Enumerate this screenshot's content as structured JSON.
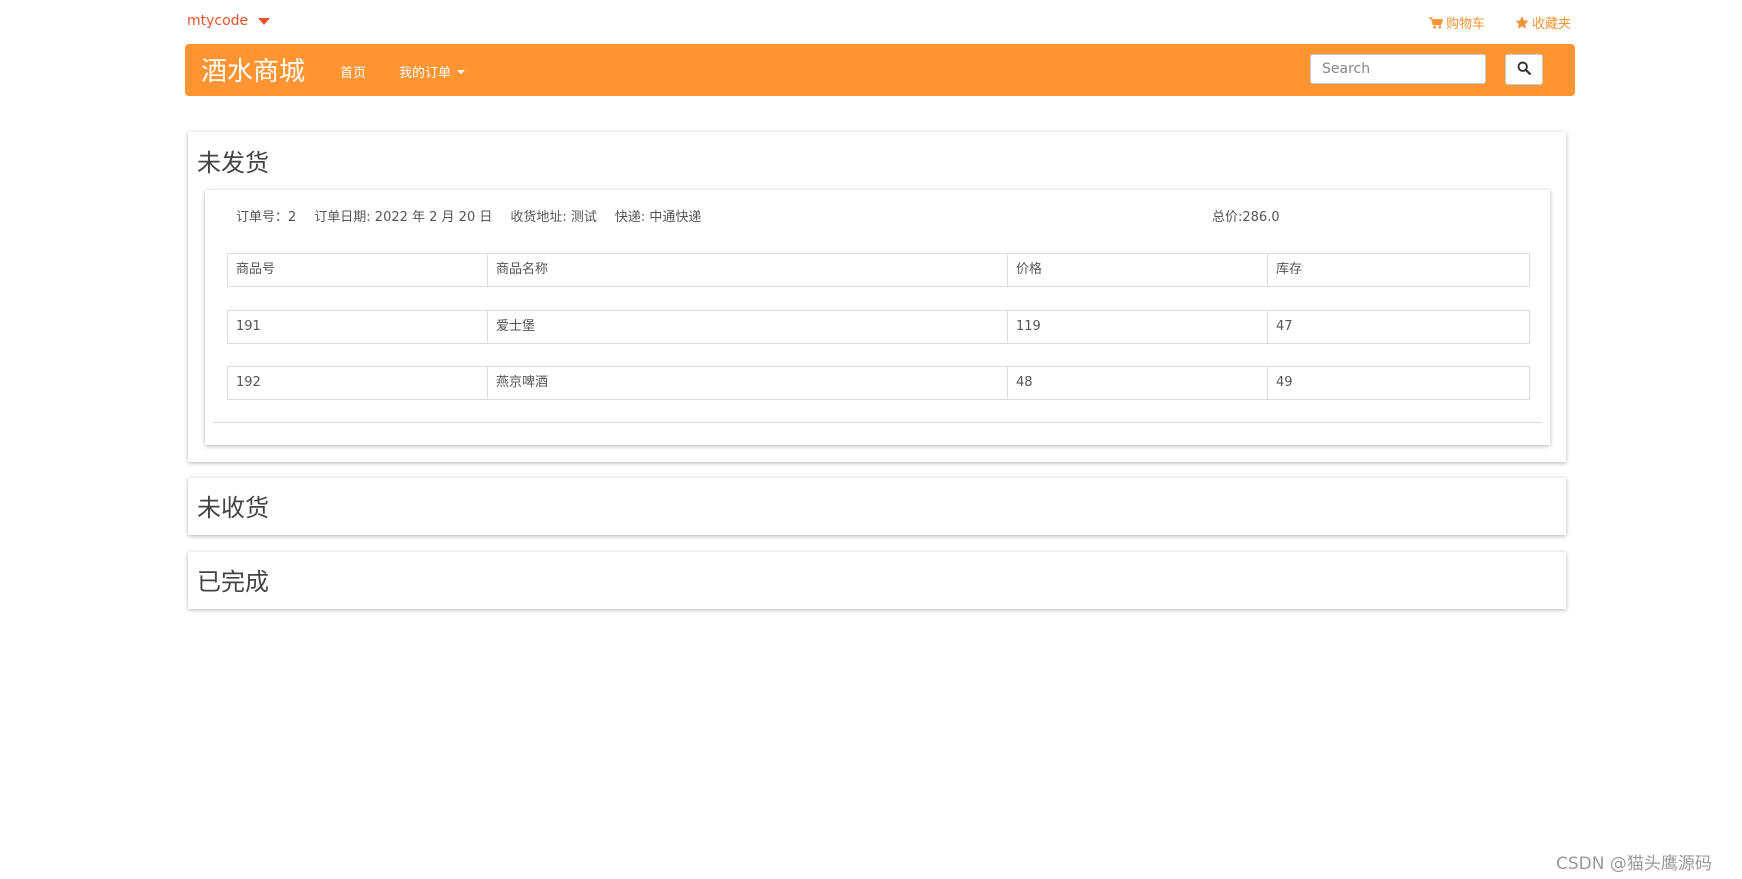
{
  "header": {
    "username": "mtycode",
    "cart_label": "购物车",
    "favorites_label": "收藏夹",
    "accent_color": "#ff9433",
    "link_color": "#f39437"
  },
  "navbar": {
    "brand": "酒水商城",
    "home_label": "首页",
    "orders_label": "我的订单",
    "search_placeholder": "Search"
  },
  "sections": {
    "unshipped_title": "未发货",
    "unreceived_title": "未收货",
    "completed_title": "已完成"
  },
  "order": {
    "number_text": "订单号：2",
    "date_text": "订单日期: 2022 年 2 月 20 日",
    "address_text": "收货地址: 测试",
    "express_text": "快递: 中通快递",
    "total_text": "总价:286.0",
    "columns": [
      "商品号",
      "商品名称",
      "价格",
      "库存"
    ],
    "rows": [
      [
        "191",
        "爱士堡",
        "119",
        "47"
      ],
      [
        "192",
        "燕京啤酒",
        "48",
        "49"
      ]
    ]
  },
  "watermark": "CSDN @猫头鹰源码"
}
